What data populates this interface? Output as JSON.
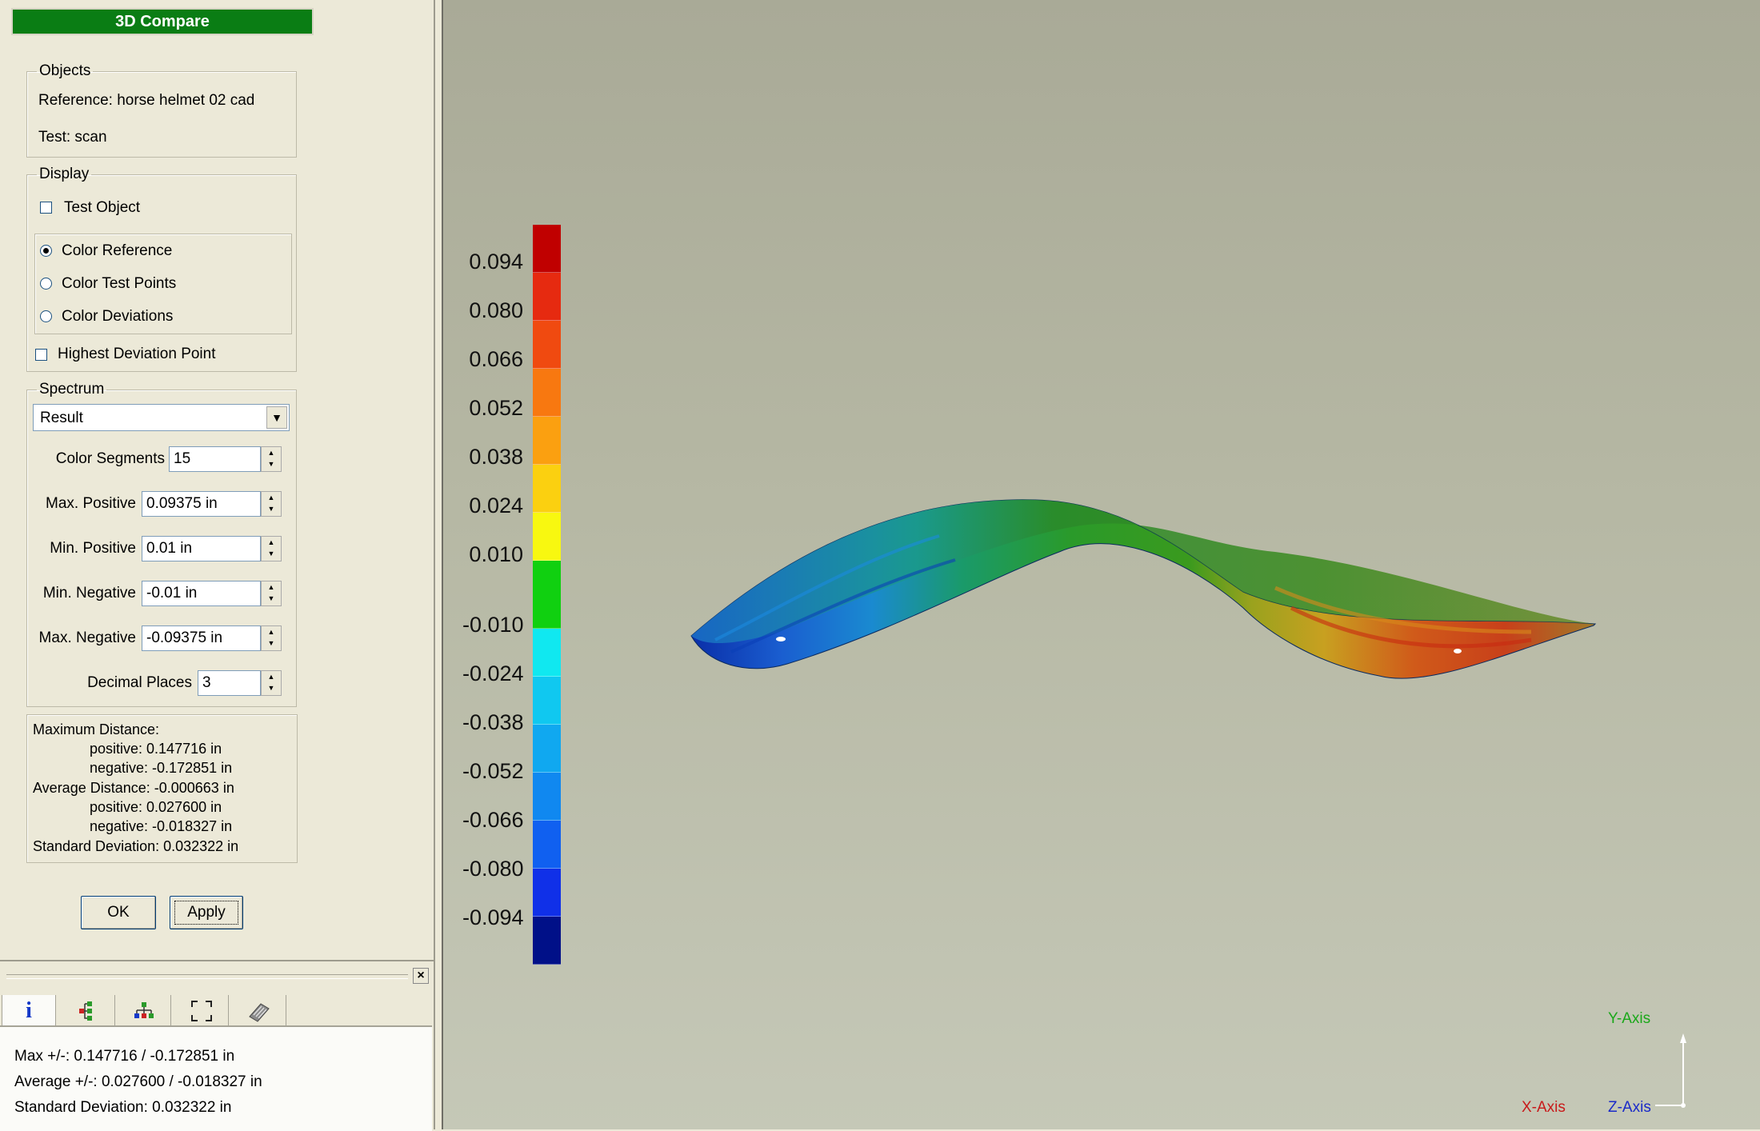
{
  "panel": {
    "title": "3D Compare",
    "objects": {
      "legend": "Objects",
      "reference": "Reference: horse helmet 02 cad",
      "test": "Test: scan"
    },
    "display": {
      "legend": "Display",
      "test_object": "Test Object",
      "color_reference": "Color Reference",
      "color_test_points": "Color Test Points",
      "color_deviations": "Color Deviations",
      "highest_deviation": "Highest Deviation Point",
      "selected": "Color Reference"
    },
    "spectrum": {
      "legend": "Spectrum",
      "mode": "Result",
      "color_segments_label": "Color Segments",
      "color_segments": "15",
      "max_positive_label": "Max. Positive",
      "max_positive": "0.09375 in",
      "min_positive_label": "Min. Positive",
      "min_positive": "0.01 in",
      "min_negative_label": "Min. Negative",
      "min_negative": "-0.01 in",
      "max_negative_label": "Max. Negative",
      "max_negative": "-0.09375 in",
      "decimal_places_label": "Decimal Places",
      "decimal_places": "3"
    },
    "stats": {
      "max_distance": "Maximum Distance:",
      "max_pos": "positive: 0.147716 in",
      "max_neg": "negative: -0.172851 in",
      "avg_distance": "Average Distance: -0.000663 in",
      "avg_pos": "positive: 0.027600 in",
      "avg_neg": "negative: -0.018327 in",
      "std_dev": "Standard Deviation: 0.032322 in"
    },
    "ok_label": "OK",
    "apply_label": "Apply"
  },
  "info_panel": {
    "close": "×",
    "tab_info": "i",
    "line1": "Max +/-: 0.147716 / -0.172851 in",
    "line2": "Average +/-: 0.027600 / -0.018327 in",
    "line3": "Standard Deviation: 0.032322 in"
  },
  "legend_scale": {
    "ticks": [
      "0.094",
      "0.080",
      "0.066",
      "0.052",
      "0.038",
      "0.024",
      "0.010",
      "-0.010",
      "-0.024",
      "-0.038",
      "-0.052",
      "-0.066",
      "-0.080",
      "-0.094"
    ],
    "colors": [
      "#c00000",
      "#e62a10",
      "#f04a10",
      "#f87810",
      "#fba010",
      "#fbd010",
      "#f8f810",
      "#10d010",
      "#10e8f0",
      "#10c8f0",
      "#10a8f0",
      "#1088f0",
      "#1060f0",
      "#1030e8",
      "#001088"
    ]
  },
  "axes": {
    "y": "Y-Axis",
    "x": "X-Axis",
    "z": "Z-Axis"
  }
}
